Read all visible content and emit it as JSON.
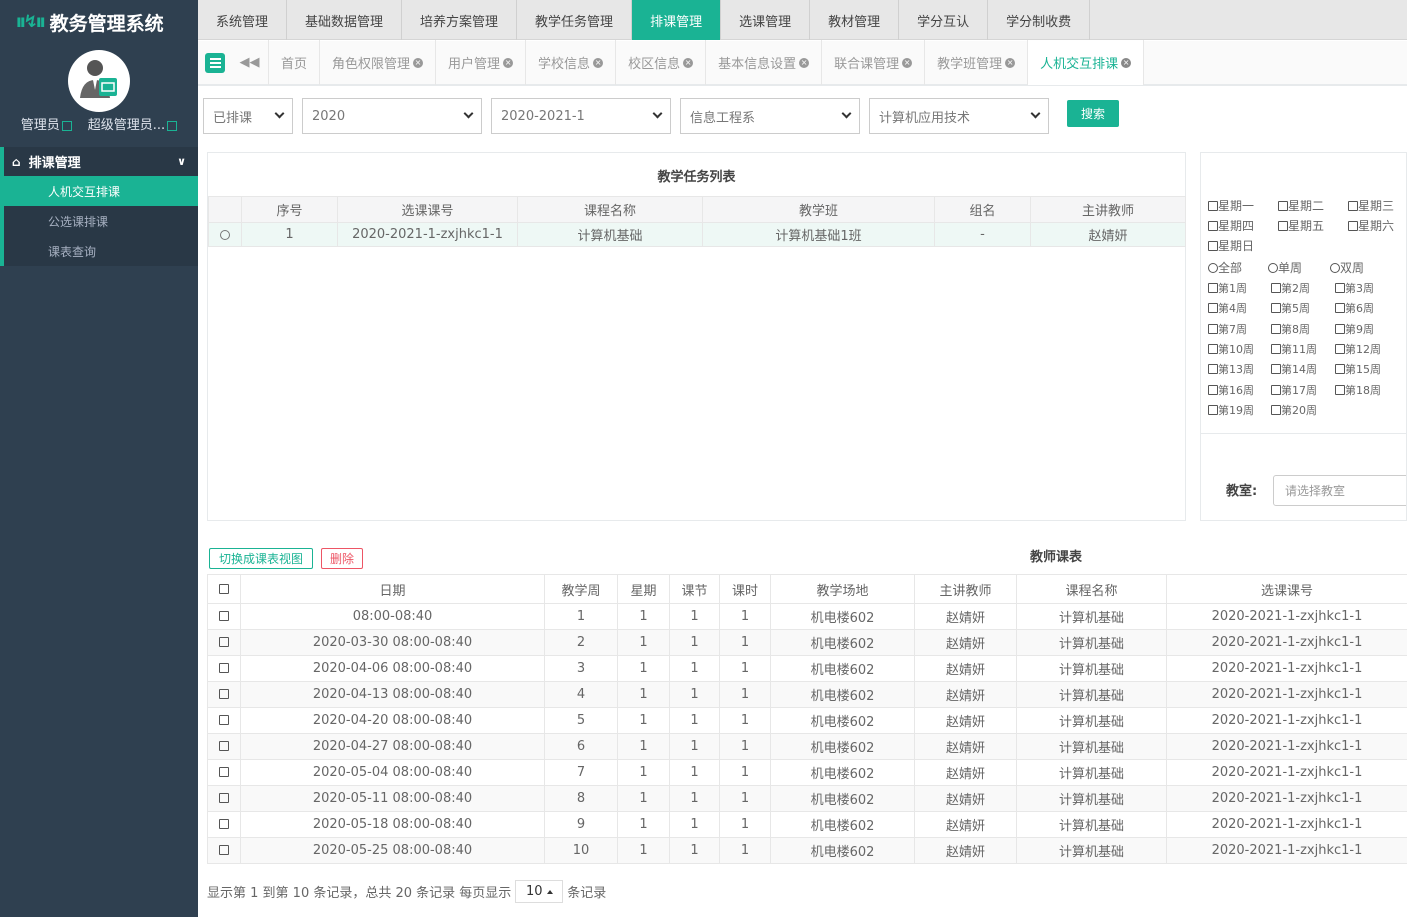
{
  "app": {
    "title": "教务管理系统"
  },
  "user": {
    "role": "管理员",
    "name": "超级管理员..."
  },
  "sidebar": {
    "section": "排课管理",
    "items": [
      {
        "label": "人机交互排课",
        "active": true
      },
      {
        "label": "公选课排课",
        "active": false
      },
      {
        "label": "课表查询",
        "active": false
      }
    ]
  },
  "topmenu": [
    {
      "label": "系统管理",
      "active": false
    },
    {
      "label": "基础数据管理",
      "active": false
    },
    {
      "label": "培养方案管理",
      "active": false
    },
    {
      "label": "教学任务管理",
      "active": false
    },
    {
      "label": "排课管理",
      "active": true
    },
    {
      "label": "选课管理",
      "active": false
    },
    {
      "label": "教材管理",
      "active": false
    },
    {
      "label": "学分互认",
      "active": false
    },
    {
      "label": "学分制收费",
      "active": false
    }
  ],
  "tabs": [
    {
      "label": "首页",
      "closable": false,
      "active": false
    },
    {
      "label": "角色权限管理",
      "closable": true,
      "active": false
    },
    {
      "label": "用户管理",
      "closable": true,
      "active": false
    },
    {
      "label": "学校信息",
      "closable": true,
      "active": false
    },
    {
      "label": "校区信息",
      "closable": true,
      "active": false
    },
    {
      "label": "基本信息设置",
      "closable": true,
      "active": false
    },
    {
      "label": "联合课管理",
      "closable": true,
      "active": false
    },
    {
      "label": "教学班管理",
      "closable": true,
      "active": false
    },
    {
      "label": "人机交互排课",
      "closable": true,
      "active": true
    }
  ],
  "filters": {
    "status": "已排课",
    "year": "2020",
    "term": "2020-2021-1",
    "department": "信息工程系",
    "major": "计算机应用技术",
    "search_label": "搜索"
  },
  "task_list": {
    "title": "教学任务列表",
    "columns": [
      "",
      "序号",
      "选课课号",
      "课程名称",
      "教学班",
      "组名",
      "主讲教师"
    ],
    "rows": [
      [
        "",
        "1",
        "2020-2021-1-zxjhkc1-1",
        "计算机基础",
        "计算机基础1班",
        "-",
        "赵婧妍"
      ]
    ]
  },
  "options": {
    "weekdays": [
      "星期一",
      "星期二",
      "星期三",
      "星期四",
      "星期五",
      "星期六",
      "星期日"
    ],
    "week_types": [
      "全部",
      "单周",
      "双周"
    ],
    "weeks": [
      "第1周",
      "第2周",
      "第3周",
      "第4周",
      "第5周",
      "第6周",
      "第7周",
      "第8周",
      "第9周",
      "第10周",
      "第11周",
      "第12周",
      "第13周",
      "第14周",
      "第15周",
      "第16周",
      "第17周",
      "第18周",
      "第19周",
      "第20周"
    ],
    "classroom_label": "教室:",
    "classroom_placeholder": "请选择教室"
  },
  "schedule": {
    "switch_label": "切换成课表视图",
    "delete_label": "删除",
    "title": "教师课表",
    "columns": [
      "",
      "日期",
      "教学周",
      "星期",
      "课节",
      "课时",
      "教学场地",
      "主讲教师",
      "课程名称",
      "选课课号"
    ],
    "rows": [
      [
        "08:00-08:40",
        "1",
        "1",
        "1",
        "1",
        "机电楼602",
        "赵婧妍",
        "计算机基础",
        "2020-2021-1-zxjhkc1-1"
      ],
      [
        "2020-03-30 08:00-08:40",
        "2",
        "1",
        "1",
        "1",
        "机电楼602",
        "赵婧妍",
        "计算机基础",
        "2020-2021-1-zxjhkc1-1"
      ],
      [
        "2020-04-06 08:00-08:40",
        "3",
        "1",
        "1",
        "1",
        "机电楼602",
        "赵婧妍",
        "计算机基础",
        "2020-2021-1-zxjhkc1-1"
      ],
      [
        "2020-04-13 08:00-08:40",
        "4",
        "1",
        "1",
        "1",
        "机电楼602",
        "赵婧妍",
        "计算机基础",
        "2020-2021-1-zxjhkc1-1"
      ],
      [
        "2020-04-20 08:00-08:40",
        "5",
        "1",
        "1",
        "1",
        "机电楼602",
        "赵婧妍",
        "计算机基础",
        "2020-2021-1-zxjhkc1-1"
      ],
      [
        "2020-04-27 08:00-08:40",
        "6",
        "1",
        "1",
        "1",
        "机电楼602",
        "赵婧妍",
        "计算机基础",
        "2020-2021-1-zxjhkc1-1"
      ],
      [
        "2020-05-04 08:00-08:40",
        "7",
        "1",
        "1",
        "1",
        "机电楼602",
        "赵婧妍",
        "计算机基础",
        "2020-2021-1-zxjhkc1-1"
      ],
      [
        "2020-05-11 08:00-08:40",
        "8",
        "1",
        "1",
        "1",
        "机电楼602",
        "赵婧妍",
        "计算机基础",
        "2020-2021-1-zxjhkc1-1"
      ],
      [
        "2020-05-18 08:00-08:40",
        "9",
        "1",
        "1",
        "1",
        "机电楼602",
        "赵婧妍",
        "计算机基础",
        "2020-2021-1-zxjhkc1-1"
      ],
      [
        "2020-05-25 08:00-08:40",
        "10",
        "1",
        "1",
        "1",
        "机电楼602",
        "赵婧妍",
        "计算机基础",
        "2020-2021-1-zxjhkc1-1"
      ]
    ]
  },
  "pagination": {
    "text_before": "显示第 1 到第 10 条记录，总共 20 条记录 每页显示",
    "page_size": "10",
    "text_after": "条记录"
  },
  "colors": {
    "accent": "#1ab394",
    "sidebar": "#2f4050",
    "danger": "#ed5565"
  }
}
